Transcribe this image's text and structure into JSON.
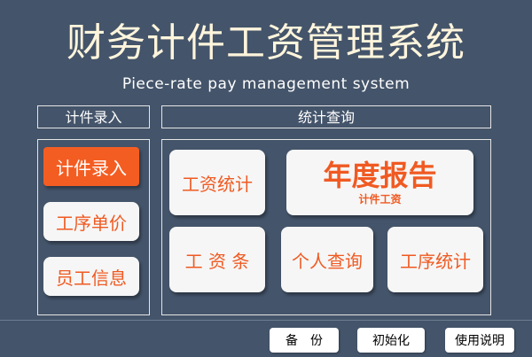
{
  "header": {
    "title": "财务计件工资管理系统",
    "subtitle": "Piece-rate pay management system"
  },
  "left_panel": {
    "label": "计件录入",
    "buttons": [
      "计件录入",
      "工序单价",
      "员工信息"
    ],
    "active_index": 0
  },
  "right_panel": {
    "label": "统计查询",
    "wage_stats": "工资统计",
    "annual_report": {
      "title": "年度报告",
      "subtitle": "计件工资"
    },
    "payslip": "工 资 条",
    "personal_query": "个人查询",
    "process_stats": "工序统计"
  },
  "footer": {
    "backup": "备　份",
    "initialize": "初始化",
    "manual": "使用说明"
  },
  "colors": {
    "background": "#44546a",
    "accent": "#f05a22",
    "title": "#fff5dc"
  }
}
